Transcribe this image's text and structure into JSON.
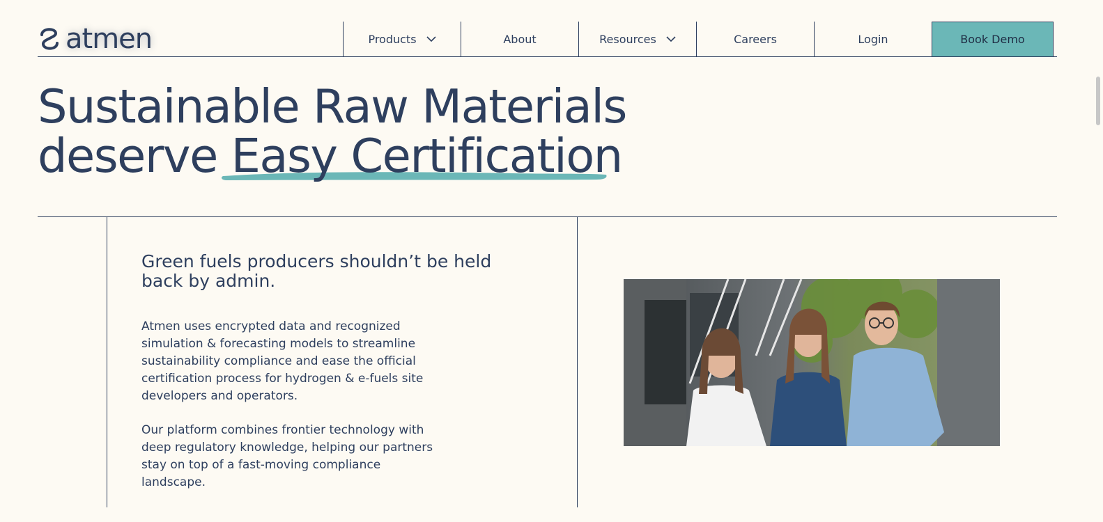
{
  "brand": {
    "name": "atmen",
    "logo_icon": "wave-link-icon"
  },
  "nav": {
    "items": [
      {
        "label": "Products",
        "has_dropdown": true
      },
      {
        "label": "About",
        "has_dropdown": false
      },
      {
        "label": "Resources",
        "has_dropdown": true
      },
      {
        "label": "Careers",
        "has_dropdown": false
      },
      {
        "label": "Login",
        "has_dropdown": false
      }
    ],
    "cta_label": "Book Demo"
  },
  "hero": {
    "line1": "Sustainable Raw Materials",
    "line2_prefix": "deserve ",
    "line2_highlight": "Easy Certification"
  },
  "intro": {
    "heading": "Green fuels producers shouldn’t be held back by admin.",
    "paragraph1": "Atmen uses encrypted data and recognized simulation & forecasting models to streamline sustainability compliance and ease the official certification process for hydrogen & e-fuels site developers and operators.",
    "paragraph2": "Our platform combines frontier technology with deep regulatory knowledge, helping our partners stay on top of a fast-moving compliance landscape."
  },
  "colors": {
    "accent": "#6bb7b7",
    "text": "#2e3f5e",
    "background": "#fdfaf3"
  },
  "photo": {
    "icon": "team-photo"
  }
}
